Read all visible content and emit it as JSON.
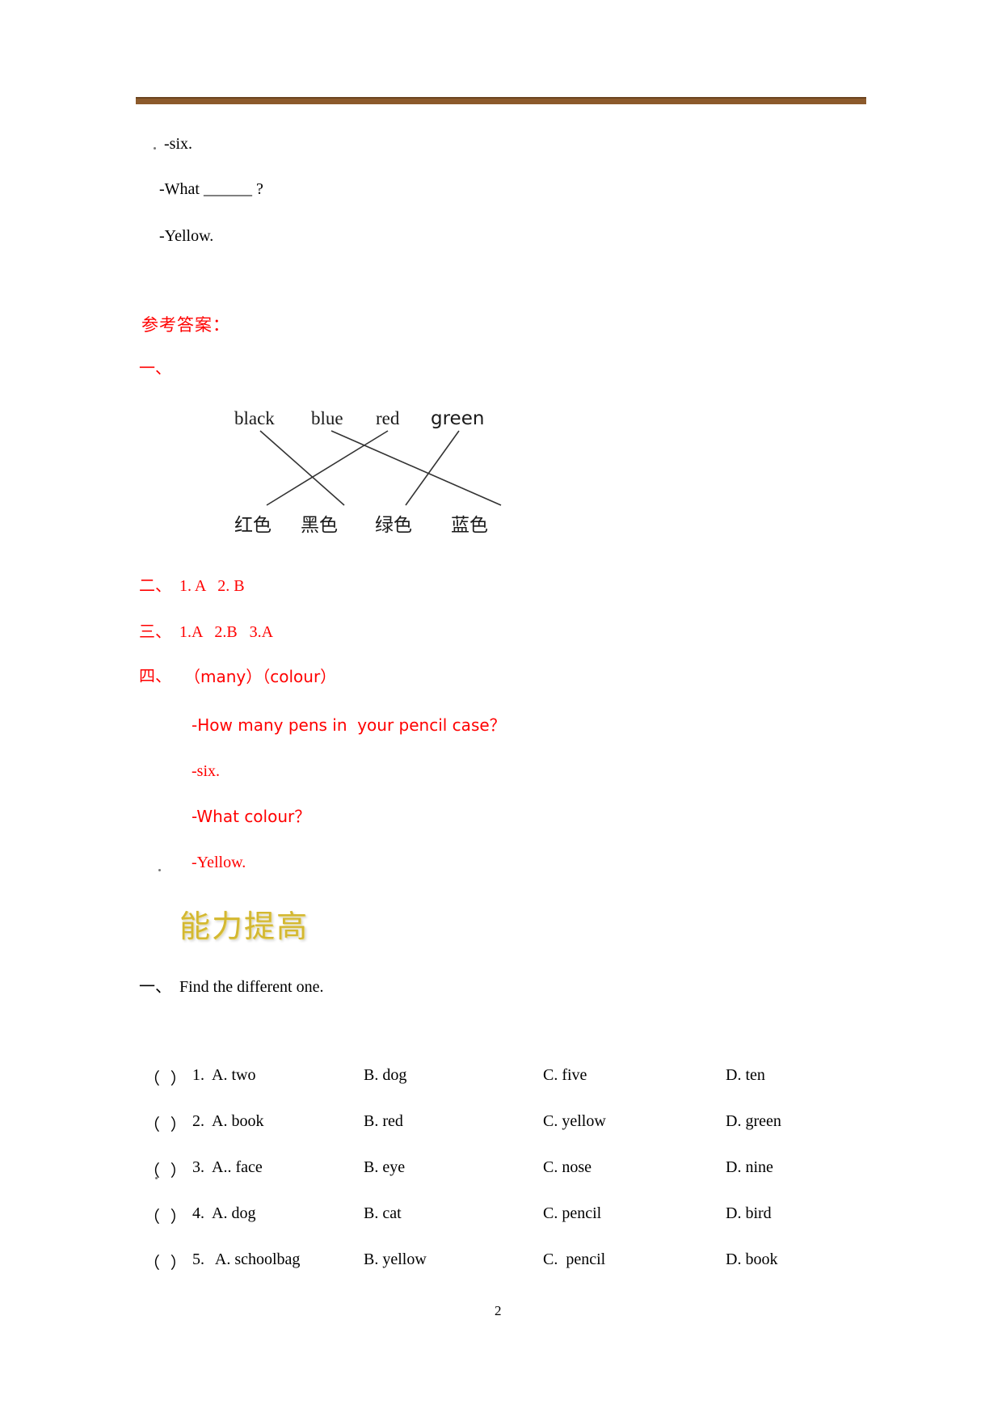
{
  "document": {
    "page_number": "2",
    "top_lines": [
      {
        "text": "-six."
      },
      {
        "text": "-What ______ ?"
      },
      {
        "text": "-Yellow."
      }
    ],
    "answers_heading": "参考答案：",
    "section_one_label": "一、",
    "matching": {
      "english": [
        "black",
        "blue",
        "red",
        "green"
      ],
      "chinese": [
        "红色",
        "黑色",
        "绿色",
        "蓝色"
      ],
      "pairs": [
        {
          "from": "black",
          "to": "黑色"
        },
        {
          "from": "blue",
          "to": "蓝色"
        },
        {
          "from": "red",
          "to": "红色"
        },
        {
          "from": "green",
          "to": "绿色"
        }
      ]
    },
    "answer_lines": [
      {
        "label": "二、",
        "text": "1. A   2. B"
      },
      {
        "label": "三、",
        "text": "1.A   2.B   3.A"
      },
      {
        "label": "四、",
        "text": "（many）（colour）"
      }
    ],
    "answer_dialogue": [
      "-How many pens in  your pencil case？",
      "-six.",
      "-What colour？",
      "-Yellow."
    ],
    "section_banner": "能力提高",
    "exercise_one": {
      "label": "一、",
      "title": "Find the different one.",
      "questions": [
        {
          "mark": "（  ）",
          "num": "1.",
          "a": "A. two",
          "b": "B. dog",
          "c": "C. five",
          "d": "D. ten"
        },
        {
          "mark": "（  ）",
          "num": "2.",
          "a": "A. book",
          "b": "B. red",
          "c": "C. yellow",
          "d": "D. green"
        },
        {
          "mark": "（  ）",
          "num": "3.",
          "a": "A.. face",
          "b": "B. eye",
          "c": "C. nose",
          "d": "D. nine"
        },
        {
          "mark": "（  ）",
          "num": "4.",
          "a": "A. dog",
          "b": "B. cat",
          "c": "C. pencil",
          "d": "D. bird"
        },
        {
          "mark": "（  ）",
          "num": "5.",
          "a": " A. schoolbag",
          "b": "B. yellow",
          "c": "C.  pencil",
          "d": "D. book"
        }
      ]
    }
  }
}
